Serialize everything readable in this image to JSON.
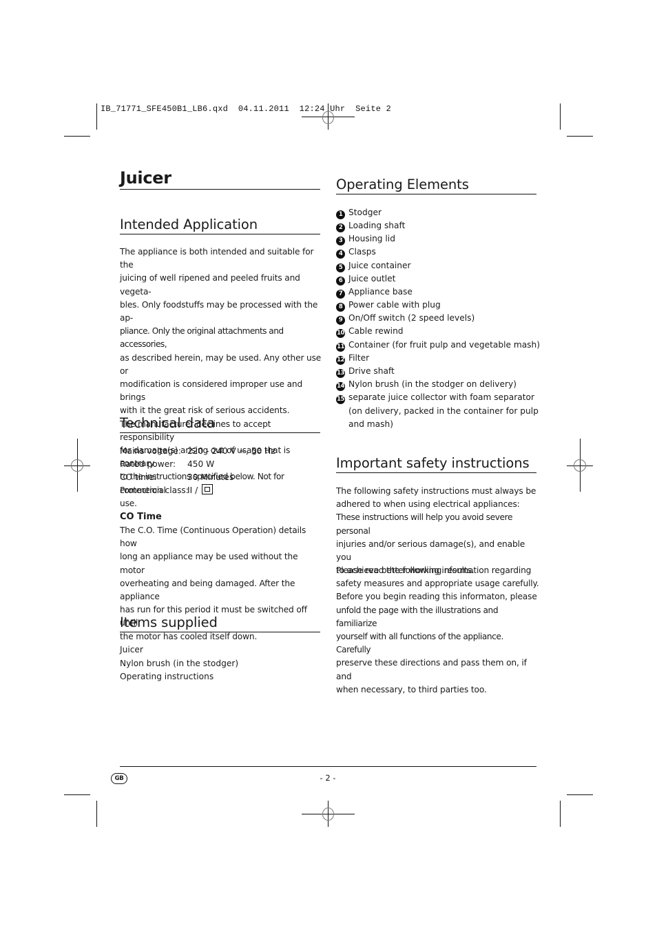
{
  "slug": {
    "filename": "IB_71771_SFE450B1_LB6.qxd",
    "date": "04.11.2011",
    "time": "12:24 Uhr",
    "page": "Seite 2"
  },
  "document": {
    "title": "Juicer",
    "intended_application": {
      "heading": "Intended Application",
      "lines": [
        "The appliance is both intended and suitable for the",
        "juicing of well ripened and peeled fruits and vegeta-",
        "bles. Only foodstuffs may be processed with the ap-",
        "pliance. Only the original attachments and accessories,",
        "as described herein, may be used. Any other use or",
        "modification is considered improper use and brings",
        "with it the great risk of serious accidents.",
        "The manufacturer declines to accept responsibility",
        "for damage(s) arising out of usage that is contrary",
        "to the instructions specified below. Not for commercial",
        "use."
      ]
    },
    "technical_data": {
      "heading": "Technical data",
      "rows": [
        {
          "label": "Mains voltage:",
          "value": "220 - 240 V ~, 50 Hz"
        },
        {
          "label": "Rated power:",
          "value": "450 W"
        },
        {
          "label": "CO time:",
          "value": "30 Minutes"
        },
        {
          "label": "Protection class:",
          "value": "II /"
        }
      ],
      "protection_symbol": "double-insulation-icon",
      "co_time": {
        "heading": "CO Time",
        "lines": [
          "The C.O. Time (Continuous Operation) details how",
          "long an appliance may be used without the motor",
          "overheating and being damaged. After the appliance",
          "has run for this period it must be switched off until",
          "the motor has cooled itself down."
        ]
      }
    },
    "items_supplied": {
      "heading": "Items supplied",
      "items": [
        "Juicer",
        "Nylon brush (in the stodger)",
        "Operating instructions"
      ]
    },
    "operating_elements": {
      "heading": "Operating Elements",
      "items": [
        {
          "num": "1",
          "label": "Stodger"
        },
        {
          "num": "2",
          "label": "Loading shaft"
        },
        {
          "num": "3",
          "label": "Housing lid"
        },
        {
          "num": "4",
          "label": "Clasps"
        },
        {
          "num": "5",
          "label": "Juice container"
        },
        {
          "num": "6",
          "label": "Juice outlet"
        },
        {
          "num": "7",
          "label": "Appliance base"
        },
        {
          "num": "8",
          "label": "Power cable with plug"
        },
        {
          "num": "9",
          "label": "On/Off switch (2 speed levels)"
        },
        {
          "num": "10",
          "label": "Cable rewind"
        },
        {
          "num": "11",
          "label": "Container (for fruit pulp and vegetable mash)"
        },
        {
          "num": "12",
          "label": "Filter"
        },
        {
          "num": "13",
          "label": "Drive shaft"
        },
        {
          "num": "14",
          "label": "Nylon brush (in the stodger on delivery)"
        },
        {
          "num": "15",
          "label": "separate juice collector with foam separator"
        }
      ],
      "item15_continuation": [
        "(on delivery, packed in the container for pulp",
        "and mash)"
      ]
    },
    "safety": {
      "heading": "Important safety instructions",
      "para1": [
        "The following safety instructions must always be",
        "adhered to when using electrical appliances:",
        "These instructions will help you avoid severe personal",
        "injuries and/or serious damage(s), and enable you",
        "to achieve better working results."
      ],
      "para2": [
        "Please read the following information regarding",
        "safety measures and appropriate usage carefully.",
        "Before you begin reading this informaton, please",
        "unfold the page with the illustrations and familiarize",
        "yourself with all functions of the appliance. Carefully",
        "preserve these directions and pass them on, if and",
        "when necessary, to third parties too."
      ]
    }
  },
  "footer": {
    "language_badge": "GB",
    "page_number": "- 2 -"
  }
}
